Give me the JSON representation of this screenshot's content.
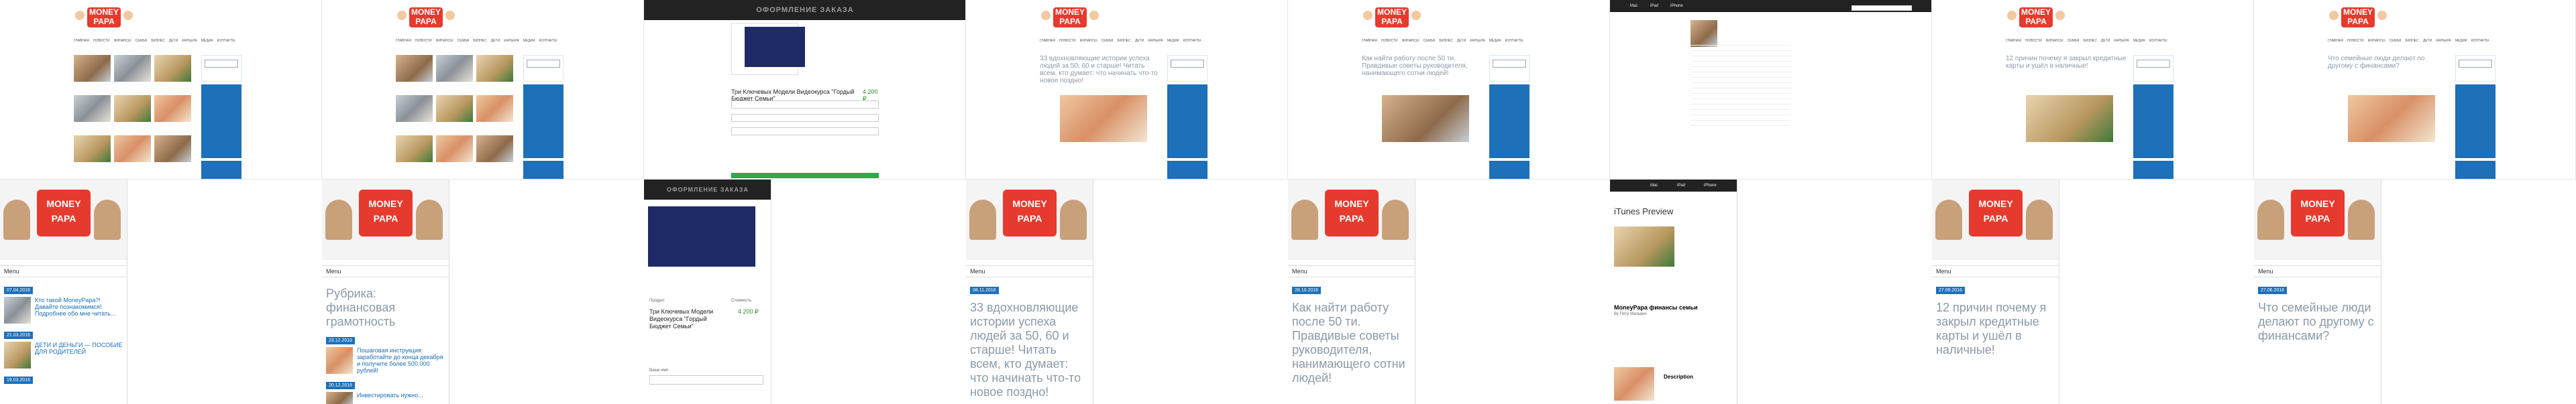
{
  "logo": {
    "line1": "MONEY",
    "line2": "PAPA"
  },
  "nav": [
    "ГЛАВНАЯ",
    "НОВОСТИ",
    "ФИНАНСЫ",
    "СЕМЬЯ",
    "БИЗНЕС",
    "ДЕТИ",
    "КАРЬЕРА",
    "МЕДИА",
    "КОНТАКТЫ"
  ],
  "menu_label": "Menu",
  "panels": [
    {
      "date": "07.04.2016",
      "post1": "Кто такой MoneyPapa?! Давайте познакомимся! Подробнее обо мне читать...",
      "date2": "21.03.2016",
      "post2": "ДЕТИ И ДЕНЬГИ — ПОСОБИЕ ДЛЯ РОДИТЕЛЕЙ",
      "date3": "19.03.2016"
    },
    {
      "title": "Рубрика: финансовая грамотность",
      "date": "23.12.2016",
      "post1": "Пошаговая инструкция: заработайте до конца декабря и получите более 500 000 рублей!",
      "date2": "20.12.2016",
      "post2": "Инвестировать нужно..."
    },
    {
      "order_title": "ОФОРМЛЕНИЕ ЗАКАЗА",
      "product_name": "Три Ключевых Модели Видеокурса \"Гордый Бюджет Семьи\"",
      "col_product": "Продукт",
      "col_price": "Стоимость",
      "price": "4 200 ₽",
      "field_label": "Ваше имя"
    },
    {
      "date": "08.11.2016",
      "title": "33 вдохновляющие истории успеха людей за 50, 60 и старше! Читать всем, кто думает: что начинать что-то новое поздно!"
    },
    {
      "date": "28.10.2016",
      "title": "Как найти работу после 50 ти. Правдивые советы руководителя, нанимающего сотни людей!"
    },
    {
      "store": "iTunes Preview",
      "app_title": "MoneyPapa финансы семьи",
      "by": "By Пётр Мальвич",
      "desc": "Description",
      "top_links": [
        "Mac",
        "iPad",
        "iPhone"
      ]
    },
    {
      "date": "27.09.2016",
      "title": "12 причин почему я закрыл кредитные карты и ушёл в наличные!"
    },
    {
      "date": "27.06.2016",
      "title": "Что семейные люди делают по другому с финансами?"
    }
  ]
}
